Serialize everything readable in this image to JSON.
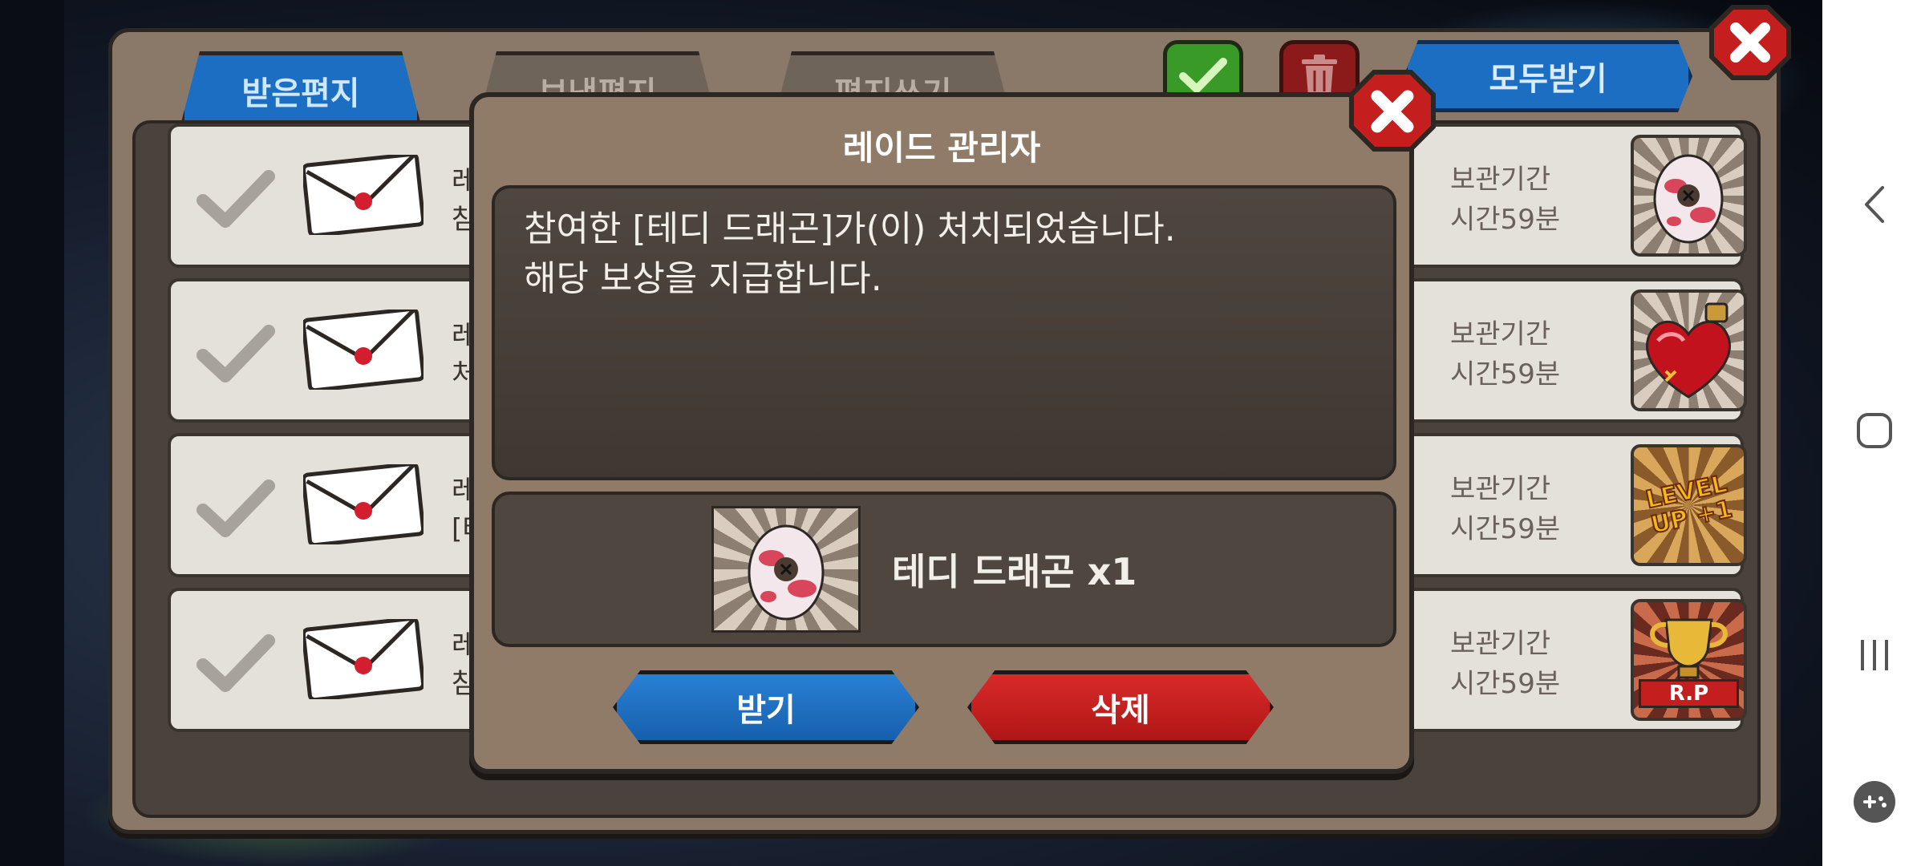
{
  "mailbox": {
    "tabs": [
      {
        "label": "받은편지",
        "active": true
      },
      {
        "label": "보낸편지",
        "active": false
      },
      {
        "label": "편지쓰기",
        "active": false
      }
    ],
    "receive_all_label": "모두받기",
    "rows": [
      {
        "sender": "레",
        "preview": "참",
        "expire_label": "보관기간",
        "expire_time": "시간59분",
        "item": "egg"
      },
      {
        "sender": "레",
        "preview": "처",
        "expire_label": "보관기간",
        "expire_time": "시간59분",
        "item": "potion"
      },
      {
        "sender": "레",
        "preview": "[터",
        "expire_label": "보관기간",
        "expire_time": "시간59분",
        "item": "level-up"
      },
      {
        "sender": "레",
        "preview": "참",
        "expire_label": "보관기간",
        "expire_time": "시간59분",
        "item": "rp-trophy"
      }
    ],
    "level_up_text": "LEVEL UP +1",
    "rp_text": "R.P"
  },
  "dialog": {
    "title": "레이드 관리자",
    "message_line1": "참여한 [테디 드래곤]가(이) 처치되었습니다.",
    "message_line2": "해당 보상을 지급합니다.",
    "reward_name": "테디 드래곤 x1",
    "receive_label": "받기",
    "delete_label": "삭제"
  },
  "colors": {
    "accent_blue": "#1b6ec2",
    "accent_red": "#c41e1e",
    "panel_brown": "#8f7b68"
  },
  "navbar": {
    "icons": [
      "back-icon",
      "home-icon",
      "recents-icon",
      "game-tools-icon"
    ]
  }
}
